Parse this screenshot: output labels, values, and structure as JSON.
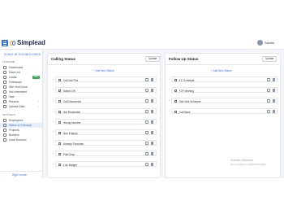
{
  "header": {
    "app_name": "Simplead",
    "user_name": "Sachin"
  },
  "sidebar": {
    "company": "SCALE 98 TECHNOLOGIES",
    "sections": {
      "leadhub": "LEADHUB",
      "settings": "SETTINGS"
    },
    "items": [
      {
        "label": "Dashboard",
        "icon": "dashboard-icon"
      },
      {
        "label": "Data List",
        "icon": "list-icon"
      },
      {
        "label": "Leads",
        "icon": "leads-icon",
        "badge": "NEW"
      },
      {
        "label": "Followups",
        "icon": "calendar-icon"
      },
      {
        "label": "Site Visit Done",
        "icon": "location-icon"
      },
      {
        "label": "Not Interested",
        "icon": "thumbs-down-icon"
      },
      {
        "label": "Sale",
        "icon": "money-icon"
      },
      {
        "label": "Reports",
        "icon": "report-icon",
        "chevron": "›"
      },
      {
        "label": "Upload Data",
        "icon": "upload-icon",
        "chevron": "›"
      }
    ],
    "settings_items": [
      {
        "label": "Employees",
        "icon": "employees-icon"
      },
      {
        "label": "Status & Followup",
        "icon": "status-icon"
      },
      {
        "label": "Projects",
        "icon": "projects-icon"
      },
      {
        "label": "Builders",
        "icon": "builders-icon"
      },
      {
        "label": "Lead Sources",
        "icon": "sources-icon"
      }
    ],
    "right_mode": "Right mode"
  },
  "calling_status": {
    "title": "Calling Status",
    "update_label": "Update",
    "add_label": "+ Add New Status",
    "items": [
      "Call Not Pick",
      "Switch Off",
      "Call Disconnect",
      "Not Reachable",
      "Wrong Number",
      "Non Enquiry",
      "Already Purchase",
      "Plan Drop",
      "Low Budget"
    ]
  },
  "follow_up_status": {
    "title": "Follow Up Status",
    "update_label": "Update",
    "add_label": "+ Add New Status",
    "items": [
      "FC Schedule",
      "F2F Meeting",
      "Site Visit Schedule",
      "Call Back"
    ]
  },
  "watermark": {
    "line1": "Activate Windows",
    "line2": "Go to Settings to activate Windows."
  },
  "colors": {
    "accent": "#2f6fed",
    "logo_orange": "#f29c1f",
    "badge_green": "#2fa84f"
  }
}
